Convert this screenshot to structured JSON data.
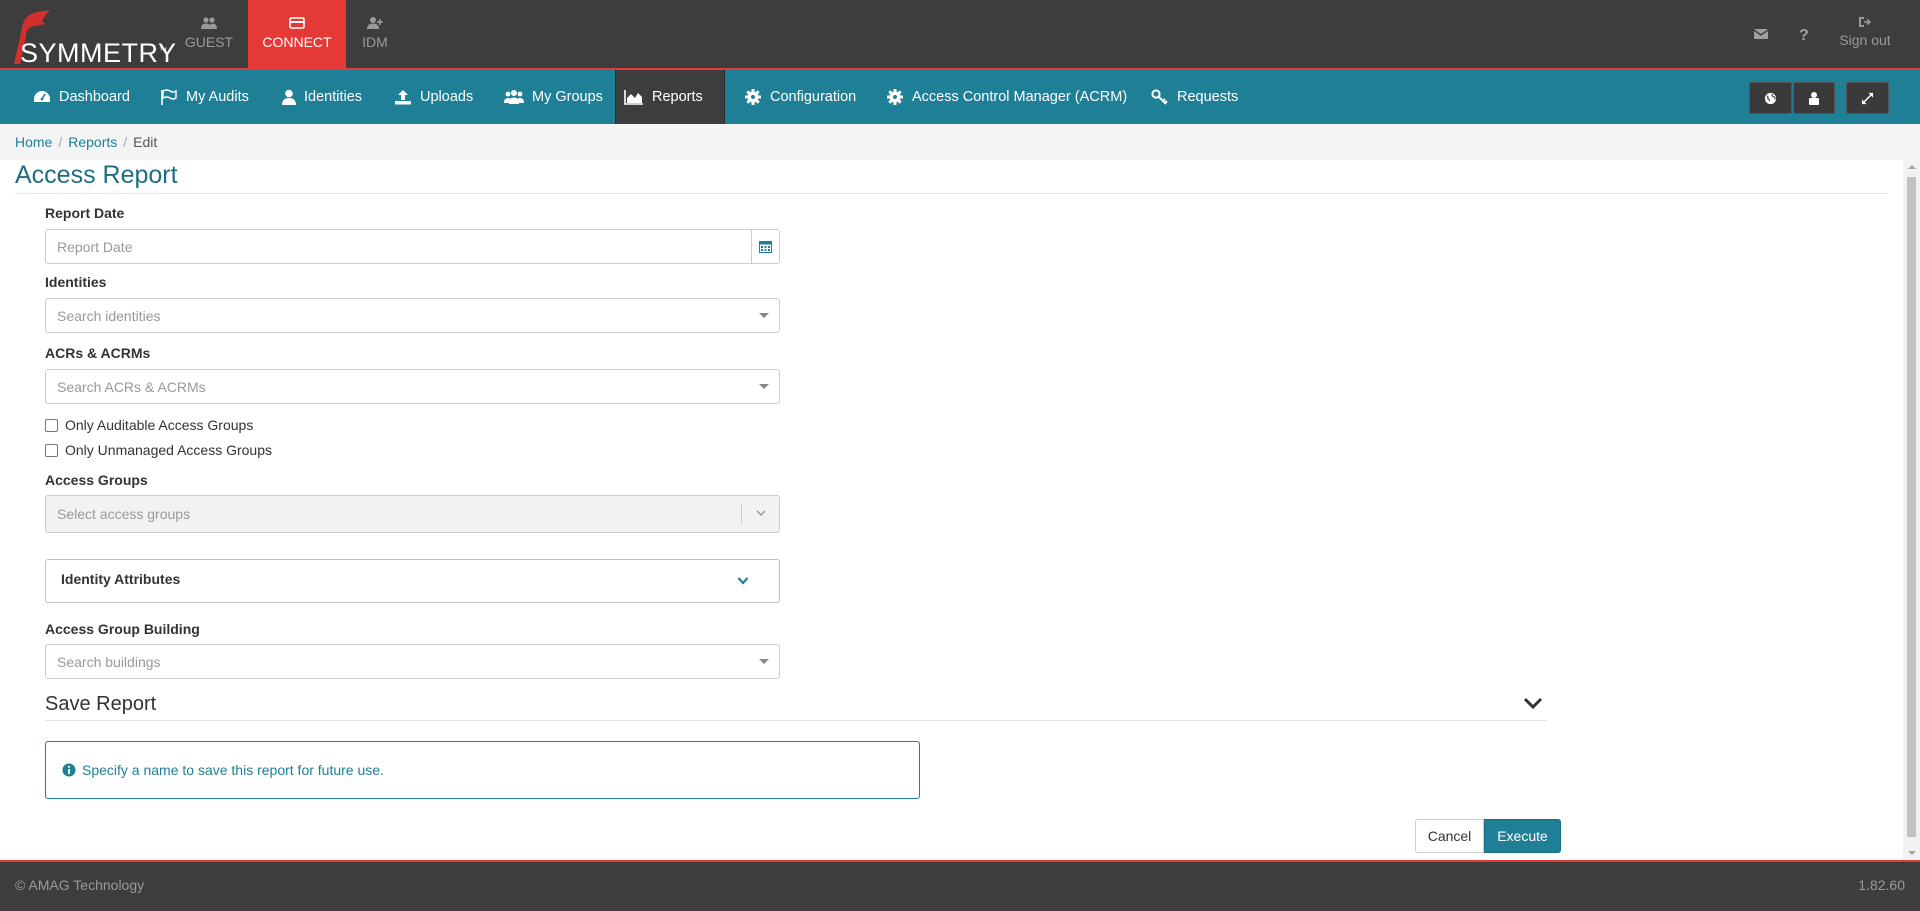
{
  "topbar": {
    "logo_text": "SYMMETRY",
    "logo_tm": "™",
    "apps": [
      {
        "label": "GUEST",
        "icon": "users-icon"
      },
      {
        "label": "CONNECT",
        "icon": "card-icon",
        "active": true
      },
      {
        "label": "IDM",
        "icon": "user-plus-icon"
      }
    ],
    "mail_icon": "envelope-icon",
    "help_icon": "question-icon",
    "signout_label": "Sign out"
  },
  "mainnav": {
    "items": [
      {
        "label": "Dashboard",
        "icon": "dashboard-icon"
      },
      {
        "label": "My Audits",
        "icon": "flag-icon"
      },
      {
        "label": "Identities",
        "icon": "user-icon"
      },
      {
        "label": "Uploads",
        "icon": "upload-icon"
      },
      {
        "label": "My Groups",
        "icon": "users-icon"
      },
      {
        "label": "Reports",
        "icon": "area-chart-icon",
        "active": true
      },
      {
        "label": "Configuration",
        "icon": "gear-icon"
      },
      {
        "label": "Access Control Manager (ACRM)",
        "icon": "gear-icon"
      },
      {
        "label": "Requests",
        "icon": "key-icon"
      }
    ],
    "right_buttons": [
      "globe-icon",
      "lock-user-icon",
      "expand-icon"
    ]
  },
  "breadcrumb": {
    "home": "Home",
    "reports": "Reports",
    "current": "Edit",
    "sep": "/"
  },
  "page": {
    "title": "Access Report"
  },
  "form": {
    "report_date_label": "Report Date",
    "report_date_placeholder": "Report Date",
    "identities_label": "Identities",
    "identities_placeholder": "Search identities",
    "acrs_label": "ACRs & ACRMs",
    "acrs_placeholder": "Search ACRs & ACRMs",
    "only_auditable_label": "Only Auditable Access Groups",
    "only_unmanaged_label": "Only Unmanaged Access Groups",
    "access_groups_label": "Access Groups",
    "access_groups_placeholder": "Select access groups",
    "identity_attributes_label": "Identity Attributes",
    "building_label": "Access Group Building",
    "building_placeholder": "Search buildings"
  },
  "save_report": {
    "title": "Save Report",
    "info": "Specify a name to save this report for future use."
  },
  "actions": {
    "cancel": "Cancel",
    "execute": "Execute"
  },
  "footer": {
    "copyright": "© AMAG Technology",
    "version": "1.82.60"
  },
  "colors": {
    "accent": "#1f7f96",
    "brand_red": "#e53935",
    "dark": "#3d3d3d"
  }
}
